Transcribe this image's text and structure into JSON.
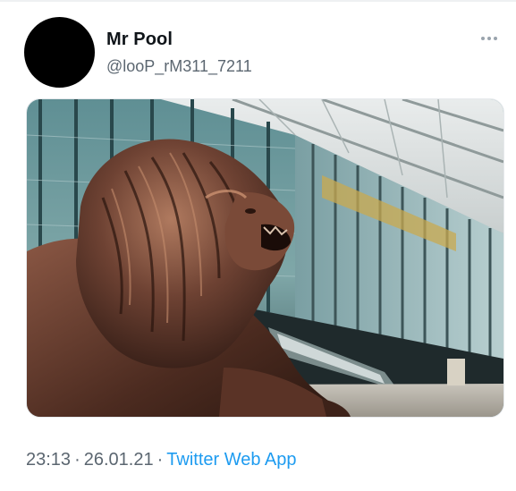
{
  "tweet": {
    "display_name": "Mr Pool",
    "handle": "@looP_rM311_7211",
    "time": "23:13",
    "date": "26.01.21",
    "separator": "·",
    "source": "Twitter Web App"
  },
  "media": {
    "subject": "bronze lion statue in front of glass office building"
  },
  "icons": {
    "more": "more-horizontal-icon"
  },
  "colors": {
    "link": "#1d9bf0",
    "secondary_text": "#5b6670",
    "primary_text": "#0f1419",
    "avatar": "#000000"
  }
}
